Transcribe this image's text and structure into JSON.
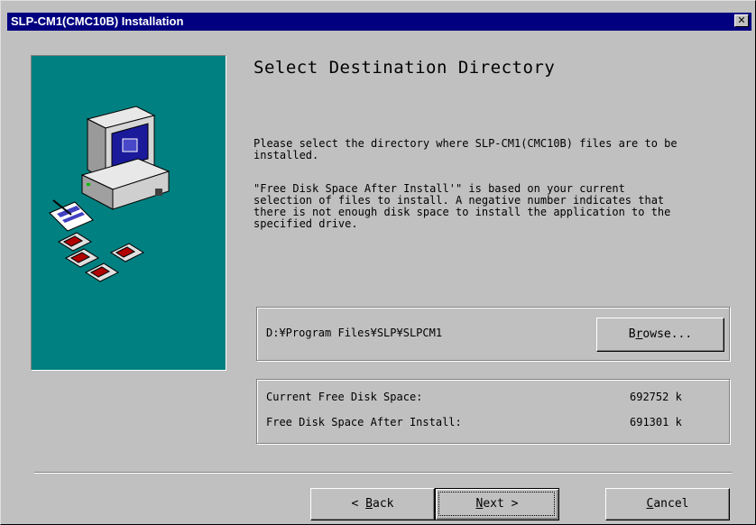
{
  "window": {
    "title": "SLP-CM1(CMC10B) Installation",
    "close_glyph": "✕"
  },
  "heading": "Select Destination Directory",
  "description": "Please select the directory where SLP-CM1(CMC10B) files are to be\ninstalled.",
  "note": "\"Free Disk Space After Install'\" is based on your current\nselection of files to install.  A negative number indicates that\nthere is not enough disk space to install the application to the\nspecified drive.",
  "destination": {
    "path": "D:¥Program Files¥SLP¥SLPCM1",
    "browse_pre": "B",
    "browse_accel": "r",
    "browse_post": "owse..."
  },
  "disk": {
    "current_label": "Current Free Disk Space:",
    "current_value": "692752 k",
    "after_label": "Free Disk Space After Install:",
    "after_value": "691301 k"
  },
  "buttons": {
    "back_pre": "< ",
    "back_accel": "B",
    "back_post": "ack",
    "next_accel": "N",
    "next_post": "ext >",
    "cancel_accel": "C",
    "cancel_post": "ancel"
  },
  "icons": {
    "panel": "computer-with-floppy-disks-icon",
    "close": "close-icon"
  },
  "colors": {
    "titlebar": "#000080",
    "panel": "#008080",
    "face": "#c0c0c0"
  }
}
